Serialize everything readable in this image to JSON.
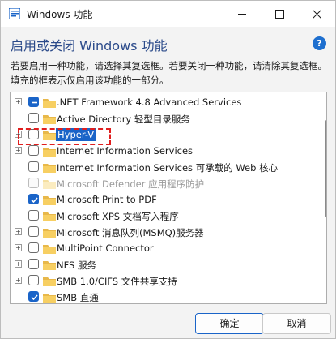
{
  "window": {
    "title": "Windows 功能",
    "heading": "启用或关闭 Windows 功能",
    "description": "若要启用一种功能，请选择其复选框。若要关闭一种功能，请清除其复选框。填充的框表示仅启用该功能的一部分。",
    "help_label": "?"
  },
  "features": [
    {
      "label": ".NET Framework 4.8 Advanced Services",
      "state": "partial",
      "expandable": true
    },
    {
      "label": "Active Directory 轻型目录服务",
      "state": "unchecked",
      "expandable": false
    },
    {
      "label": "Hyper-V",
      "state": "unchecked",
      "expandable": true,
      "selected": true
    },
    {
      "label": "Internet Information Services",
      "state": "unchecked",
      "expandable": true
    },
    {
      "label": "Internet Information Services 可承载的 Web 核心",
      "state": "unchecked",
      "expandable": false
    },
    {
      "label": "Microsoft Defender 应用程序防护",
      "state": "disabled",
      "expandable": false
    },
    {
      "label": "Microsoft Print to PDF",
      "state": "checked",
      "expandable": false
    },
    {
      "label": "Microsoft XPS 文档写入程序",
      "state": "unchecked",
      "expandable": false
    },
    {
      "label": "Microsoft 消息队列(MSMQ)服务器",
      "state": "unchecked",
      "expandable": true
    },
    {
      "label": "MultiPoint Connector",
      "state": "unchecked",
      "expandable": true
    },
    {
      "label": "NFS 服务",
      "state": "unchecked",
      "expandable": true
    },
    {
      "label": "SMB 1.0/CIFS 文件共享支持",
      "state": "unchecked",
      "expandable": true
    },
    {
      "label": "SMB 直通",
      "state": "checked",
      "expandable": false
    }
  ],
  "buttons": {
    "ok": "确定",
    "cancel": "取消"
  },
  "colors": {
    "accent": "#1a64c8",
    "heading": "#2b4a8a",
    "highlight": "#e01e1e"
  }
}
